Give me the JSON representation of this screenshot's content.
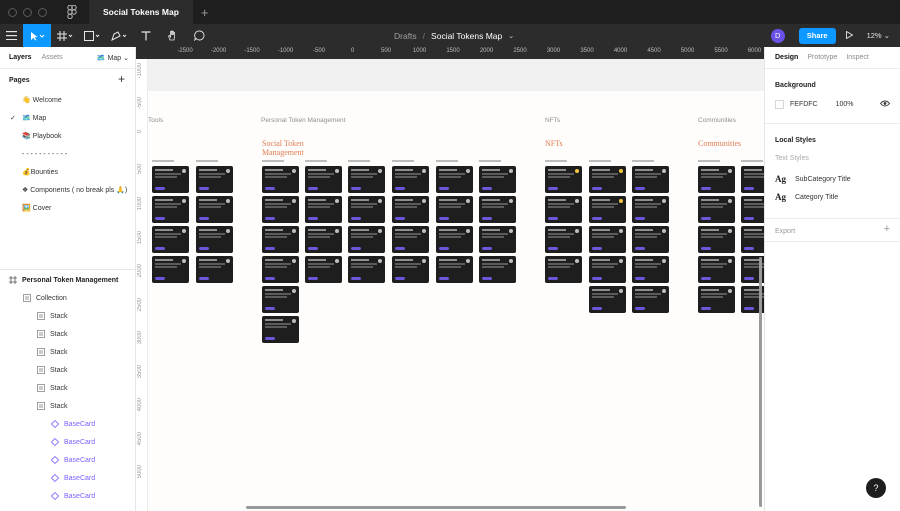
{
  "window": {
    "file_tab": "Social Tokens Map",
    "new_tab": "+"
  },
  "toolbar": {
    "crumb_drafts": "Drafts",
    "crumb_sep": "/",
    "file_name": "Social Tokens Map",
    "avatar_initial": "D",
    "share_label": "Share",
    "zoom": "12%"
  },
  "left_panel": {
    "tab_layers": "Layers",
    "tab_assets": "Assets",
    "page_selector": "🗺️ Map ⌄",
    "pages_title": "Pages",
    "pages_add": "+",
    "pages": [
      {
        "label": "👋 Welcome",
        "current": false
      },
      {
        "label": "🗺️ Map",
        "current": true
      },
      {
        "label": "📚 Playbook",
        "current": false
      },
      {
        "label": "- - - - - - - - - - -",
        "current": false
      },
      {
        "label": "💰Bounties",
        "current": false
      },
      {
        "label": "❖ Components ( no break pls 🙏)",
        "current": false
      },
      {
        "label": "🖼️ Cover",
        "current": false
      }
    ],
    "layers": [
      {
        "label": "Personal Token Management",
        "kind": "frame",
        "indent": 0
      },
      {
        "label": "Collection",
        "kind": "stack",
        "indent": 1
      },
      {
        "label": "Stack",
        "kind": "stack",
        "indent": 2
      },
      {
        "label": "Stack",
        "kind": "stack",
        "indent": 2
      },
      {
        "label": "Stack",
        "kind": "stack",
        "indent": 2
      },
      {
        "label": "Stack",
        "kind": "stack",
        "indent": 2
      },
      {
        "label": "Stack",
        "kind": "stack",
        "indent": 2
      },
      {
        "label": "Stack",
        "kind": "stack",
        "indent": 2
      },
      {
        "label": "BaseCard",
        "kind": "component",
        "indent": 3
      },
      {
        "label": "BaseCard",
        "kind": "component",
        "indent": 3
      },
      {
        "label": "BaseCard",
        "kind": "component",
        "indent": 3
      },
      {
        "label": "BaseCard",
        "kind": "component",
        "indent": 3
      },
      {
        "label": "BaseCard",
        "kind": "component",
        "indent": 3
      }
    ]
  },
  "right_panel": {
    "tab_design": "Design",
    "tab_prototype": "Prototype",
    "tab_inspect": "Inspect",
    "background_title": "Background",
    "background_hex": "FEFDFC",
    "background_opacity": "100%",
    "local_styles_title": "Local Styles",
    "text_styles_label": "Text Styles",
    "text_styles": [
      "SubCategory Title",
      "Category Title"
    ],
    "export_title": "Export",
    "export_add": "+"
  },
  "canvas": {
    "ruler_top": [
      "-2500",
      "-2000",
      "-1500",
      "-1000",
      "-500",
      "0",
      "500",
      "1000",
      "1500",
      "2000",
      "2500",
      "3000",
      "3500",
      "4000",
      "4500",
      "5000",
      "5500",
      "6000"
    ],
    "ruler_left": [
      "-1000",
      "-500",
      "0",
      "500",
      "1000",
      "1500",
      "2000",
      "2500",
      "3000",
      "3500",
      "4000",
      "4500",
      "5000"
    ],
    "section_labels": [
      "Tools",
      "Personal Token Management",
      "NFTs",
      "Communities"
    ],
    "section_titles": [
      "Social Token Management",
      "NFTs",
      "Communities"
    ]
  },
  "help_label": "?",
  "colors": {
    "accent": "#0d99ff",
    "canvas_bg": "#e5e5e5",
    "frame_bg": "#fefdfc",
    "section_title": "#e07b4f",
    "component": "#7b61ff",
    "dark_ui": "#2c2c2c"
  }
}
